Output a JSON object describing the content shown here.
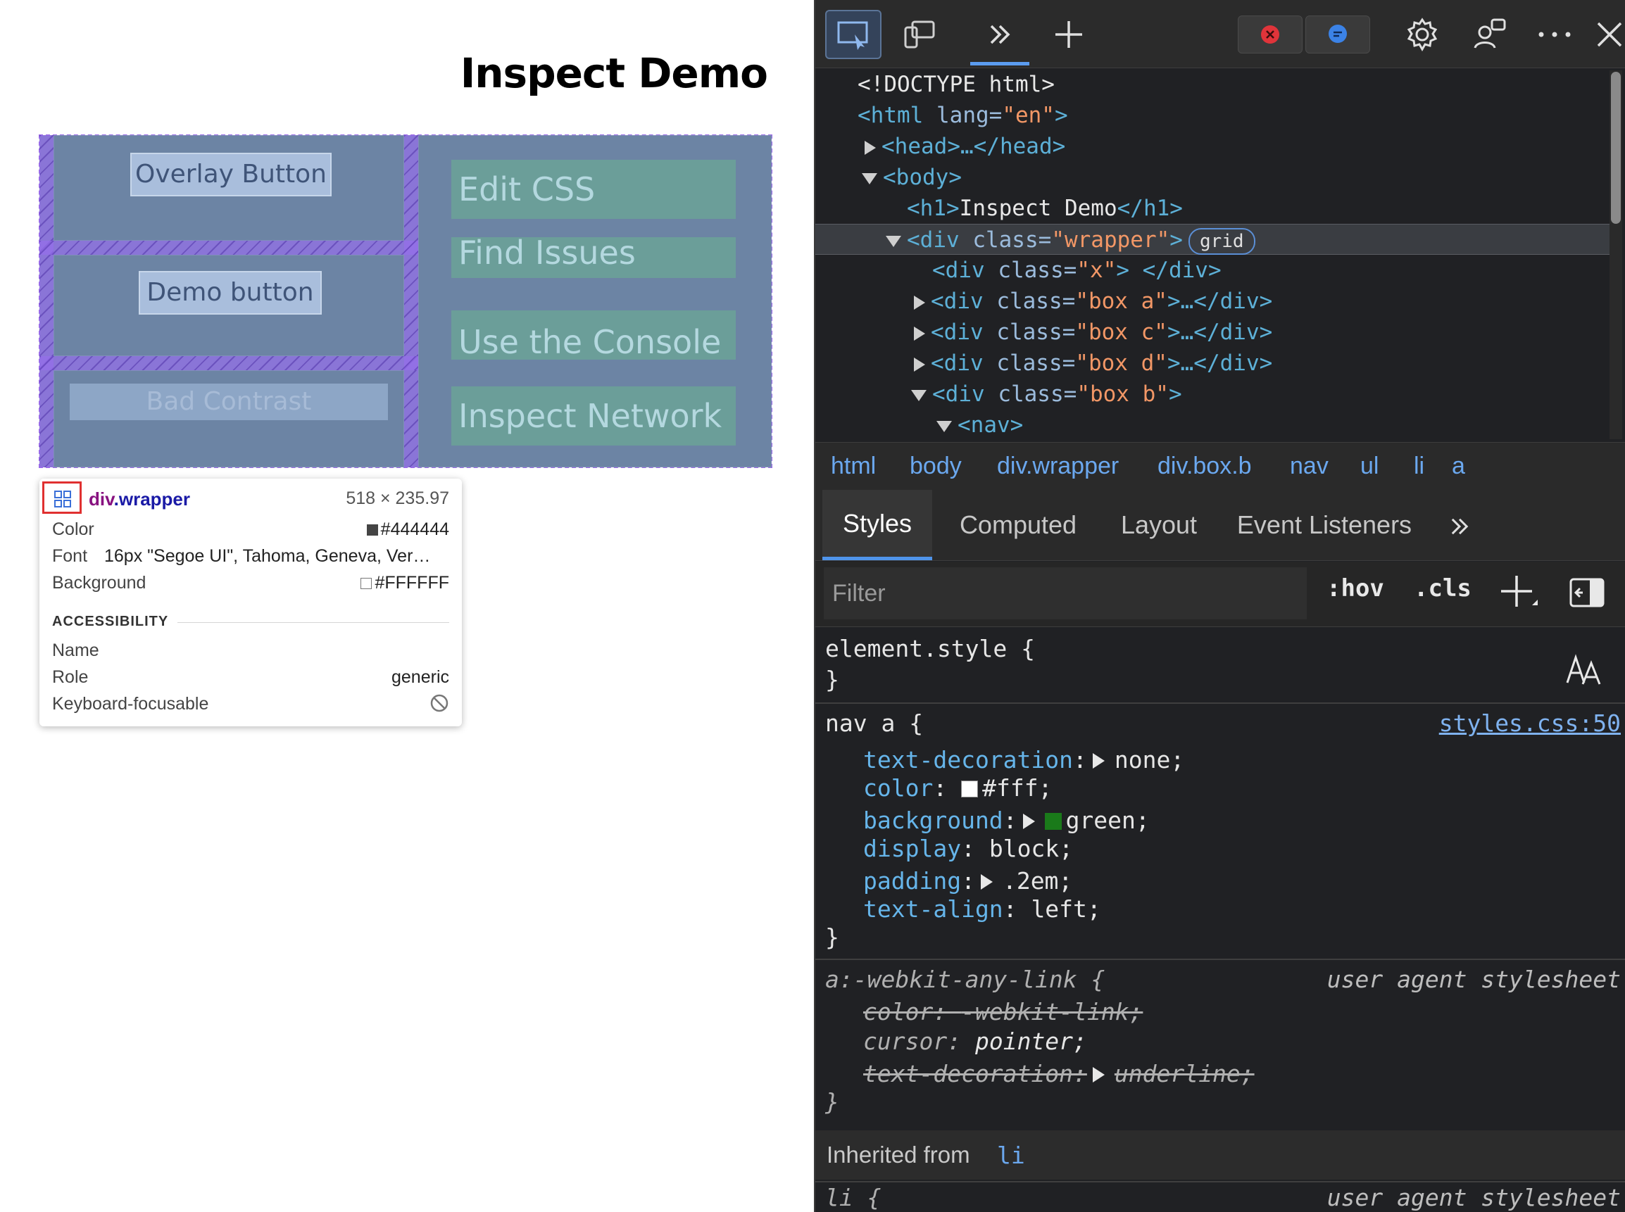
{
  "page": {
    "title": "Inspect Demo",
    "buttons": {
      "overlay": "Overlay Button",
      "demo": "Demo button",
      "bad_contrast": "Bad Contrast"
    },
    "nav_links": [
      "Edit CSS",
      "Find Issues",
      "Use the Console",
      "Inspect Network"
    ]
  },
  "tooltip": {
    "tag": "div",
    "class_name": ".wrapper",
    "size": "518 × 235.97",
    "color_label": "Color",
    "color_value": "#444444",
    "font_label": "Font",
    "font_value": "16px \"Segoe UI\", Tahoma, Geneva, Ver…",
    "background_label": "Background",
    "background_value": "#FFFFFF",
    "accessibility_heading": "ACCESSIBILITY",
    "name_label": "Name",
    "role_label": "Role",
    "role_value": "generic",
    "keyboard_label": "Keyboard-focusable",
    "icon": "grid-icon"
  },
  "colors": {
    "tooltip_color": "#444444",
    "tooltip_background": "#FFFFFF",
    "accent": "#4f94ea",
    "swatch_fff": "#ffffff",
    "swatch_green": "#1a7a1a"
  },
  "toolbar": {
    "icons": [
      "inspect-icon",
      "device-toolbar-icon",
      "more-tabs-icon",
      "new-tab-icon",
      "errors-icon",
      "issues-icon",
      "settings-icon",
      "feedback-icon",
      "more-icon",
      "close-icon"
    ]
  },
  "dom_tree": {
    "doctype": "<!DOCTYPE html>",
    "html_open": "<html",
    "html_attr": " lang=",
    "html_val": "\"en\"",
    "close_angle": ">",
    "head": "<head>…</head>",
    "body": "<body>",
    "h1_open": "<h1>",
    "h1_text": "Inspect Demo",
    "h1_close": "</h1>",
    "div_open": "<div",
    "class_attr": " class=",
    "wrapper_val": "\"wrapper\"",
    "grid_badge": "grid",
    "x_val": "\"x\"",
    "x_close": "> </div>",
    "box_a_val": "\"box a\"",
    "box_c_val": "\"box c\"",
    "box_d_val": "\"box d\"",
    "box_b_val": "\"box b\"",
    "collapsed_close": ">…</div>",
    "nav": "<nav>"
  },
  "breadcrumbs": [
    "html",
    "body",
    "div.wrapper",
    "div.box.b",
    "nav",
    "ul",
    "li",
    "a"
  ],
  "tabs": [
    "Styles",
    "Computed",
    "Layout",
    "Event Listeners"
  ],
  "filter": {
    "placeholder": "Filter",
    "hov": ":hov",
    "cls": ".cls"
  },
  "styles": {
    "element_style_open": "element.style {",
    "close_brace": "}",
    "rule1_selector": "nav a {",
    "rule1_source": "styles.css:50",
    "rule1_props": [
      {
        "name": "text-decoration",
        "value": "none;"
      },
      {
        "name": "color",
        "value": "#fff;"
      },
      {
        "name": "background",
        "value": "green;"
      },
      {
        "name": "display",
        "value": "block;"
      },
      {
        "name": "padding",
        "value": ".2em;"
      },
      {
        "name": "text-align",
        "value": "left;"
      }
    ],
    "rule2_selector": "a:-webkit-any-link {",
    "rule2_source": "user agent stylesheet",
    "rule2_props": [
      {
        "name": "color",
        "value": "-webkit-link;"
      },
      {
        "name": "cursor",
        "value": "pointer;"
      },
      {
        "name": "text-decoration",
        "value": "underline;"
      }
    ],
    "inherited_label": "Inherited from",
    "inherited_tag": "li",
    "rule3_selector": "li {",
    "rule3_source": "user agent stylesheet"
  }
}
